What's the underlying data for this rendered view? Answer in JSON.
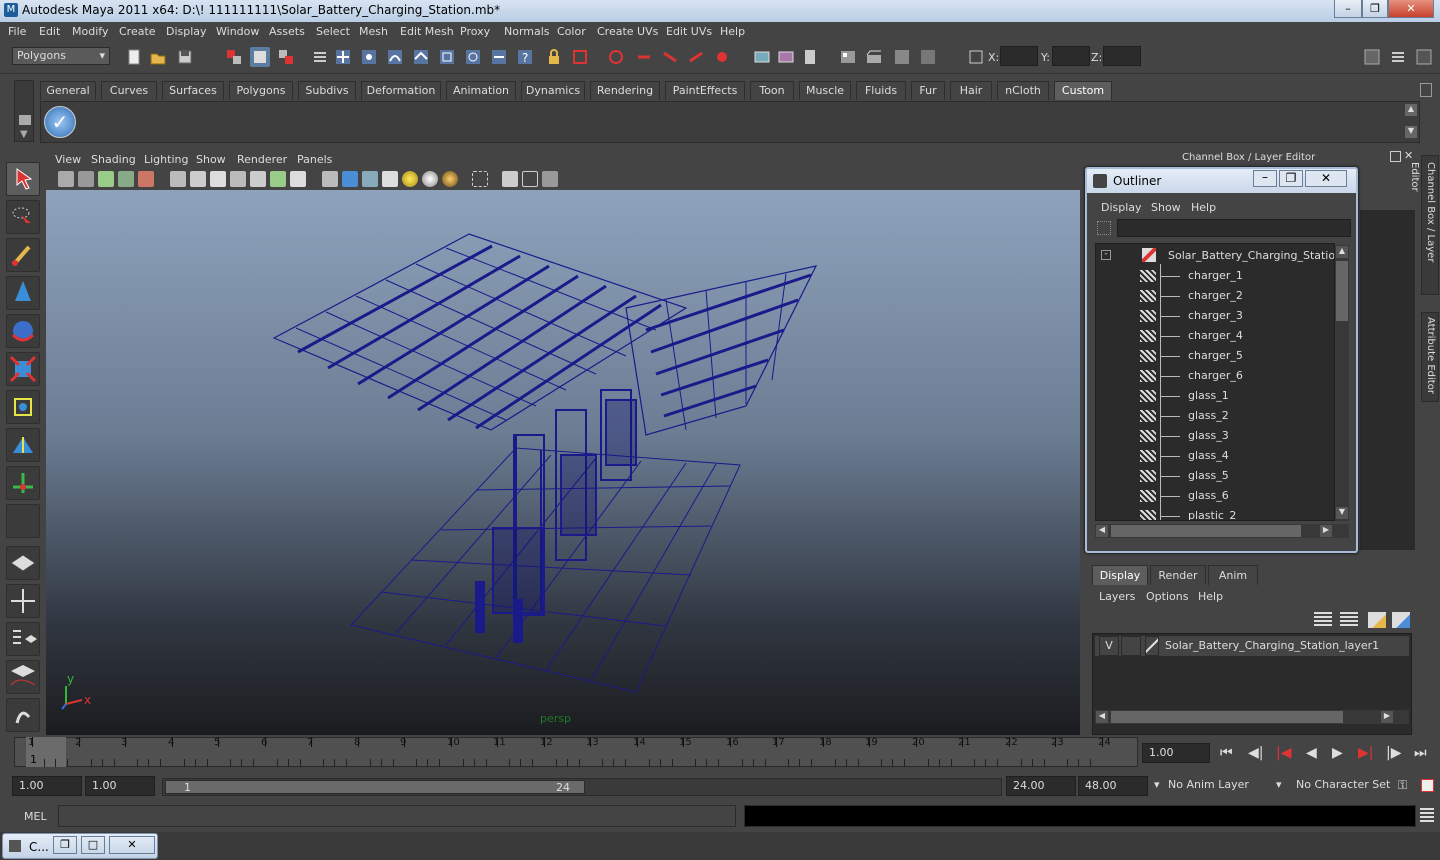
{
  "window": {
    "title": "Autodesk Maya 2011 x64: D:\\! 111111111\\Solar_Battery_Charging_Station.mb*"
  },
  "menubar": [
    "File",
    "Edit",
    "Modify",
    "Create",
    "Display",
    "Window",
    "Assets",
    "Select",
    "Mesh",
    "Edit Mesh",
    "Proxy",
    "Normals",
    "Color",
    "Create UVs",
    "Edit UVs",
    "Help"
  ],
  "toolbar": {
    "mode": "Polygons",
    "x_label": "X:",
    "y_label": "Y:",
    "z_label": "Z:"
  },
  "shelf_tabs": [
    "General",
    "Curves",
    "Surfaces",
    "Polygons",
    "Subdivs",
    "Deformation",
    "Animation",
    "Dynamics",
    "Rendering",
    "PaintEffects",
    "Toon",
    "Muscle",
    "Fluids",
    "Fur",
    "Hair",
    "nCloth",
    "Custom"
  ],
  "shelf_active_tab": "Custom",
  "viewport": {
    "menu": [
      "View",
      "Shading",
      "Lighting",
      "Show",
      "Renderer",
      "Panels"
    ],
    "camera_label": "persp",
    "axis_x": "x",
    "axis_y": "y"
  },
  "channel_box": {
    "title": "Channel Box / Layer Editor",
    "side_tabs": [
      "Channel Box / Layer Editor",
      "Attribute Editor"
    ]
  },
  "outliner": {
    "title": "Outliner",
    "menu": [
      "Display",
      "Show",
      "Help"
    ],
    "root": "Solar_Battery_Charging_Station",
    "items": [
      "charger_1",
      "charger_2",
      "charger_3",
      "charger_4",
      "charger_5",
      "charger_6",
      "glass_1",
      "glass_2",
      "glass_3",
      "glass_4",
      "glass_5",
      "glass_6",
      "plastic_2"
    ]
  },
  "layer_editor": {
    "tabs": [
      "Display",
      "Render",
      "Anim"
    ],
    "active_tab": "Display",
    "menu": [
      "Layers",
      "Options",
      "Help"
    ],
    "layer": {
      "visible": "V",
      "name": "Solar_Battery_Charging_Station_layer1"
    }
  },
  "timeslider": {
    "ticks": [
      "1",
      "2",
      "3",
      "4",
      "5",
      "6",
      "7",
      "8",
      "9",
      "10",
      "11",
      "12",
      "13",
      "14",
      "15",
      "16",
      "17",
      "18",
      "19",
      "20",
      "21",
      "22",
      "23",
      "24"
    ],
    "current_frame": "1",
    "current_time_field": "1.00"
  },
  "range": {
    "start_time": "1.00",
    "playback_start": "1.00",
    "range_start": "1",
    "range_end": "24",
    "playback_end": "24.00",
    "end_time": "48.00",
    "anim_layer": "No Anim Layer",
    "character_set": "No Character Set"
  },
  "command_line": {
    "label": "MEL"
  },
  "taskbar": {
    "item": "C..."
  }
}
